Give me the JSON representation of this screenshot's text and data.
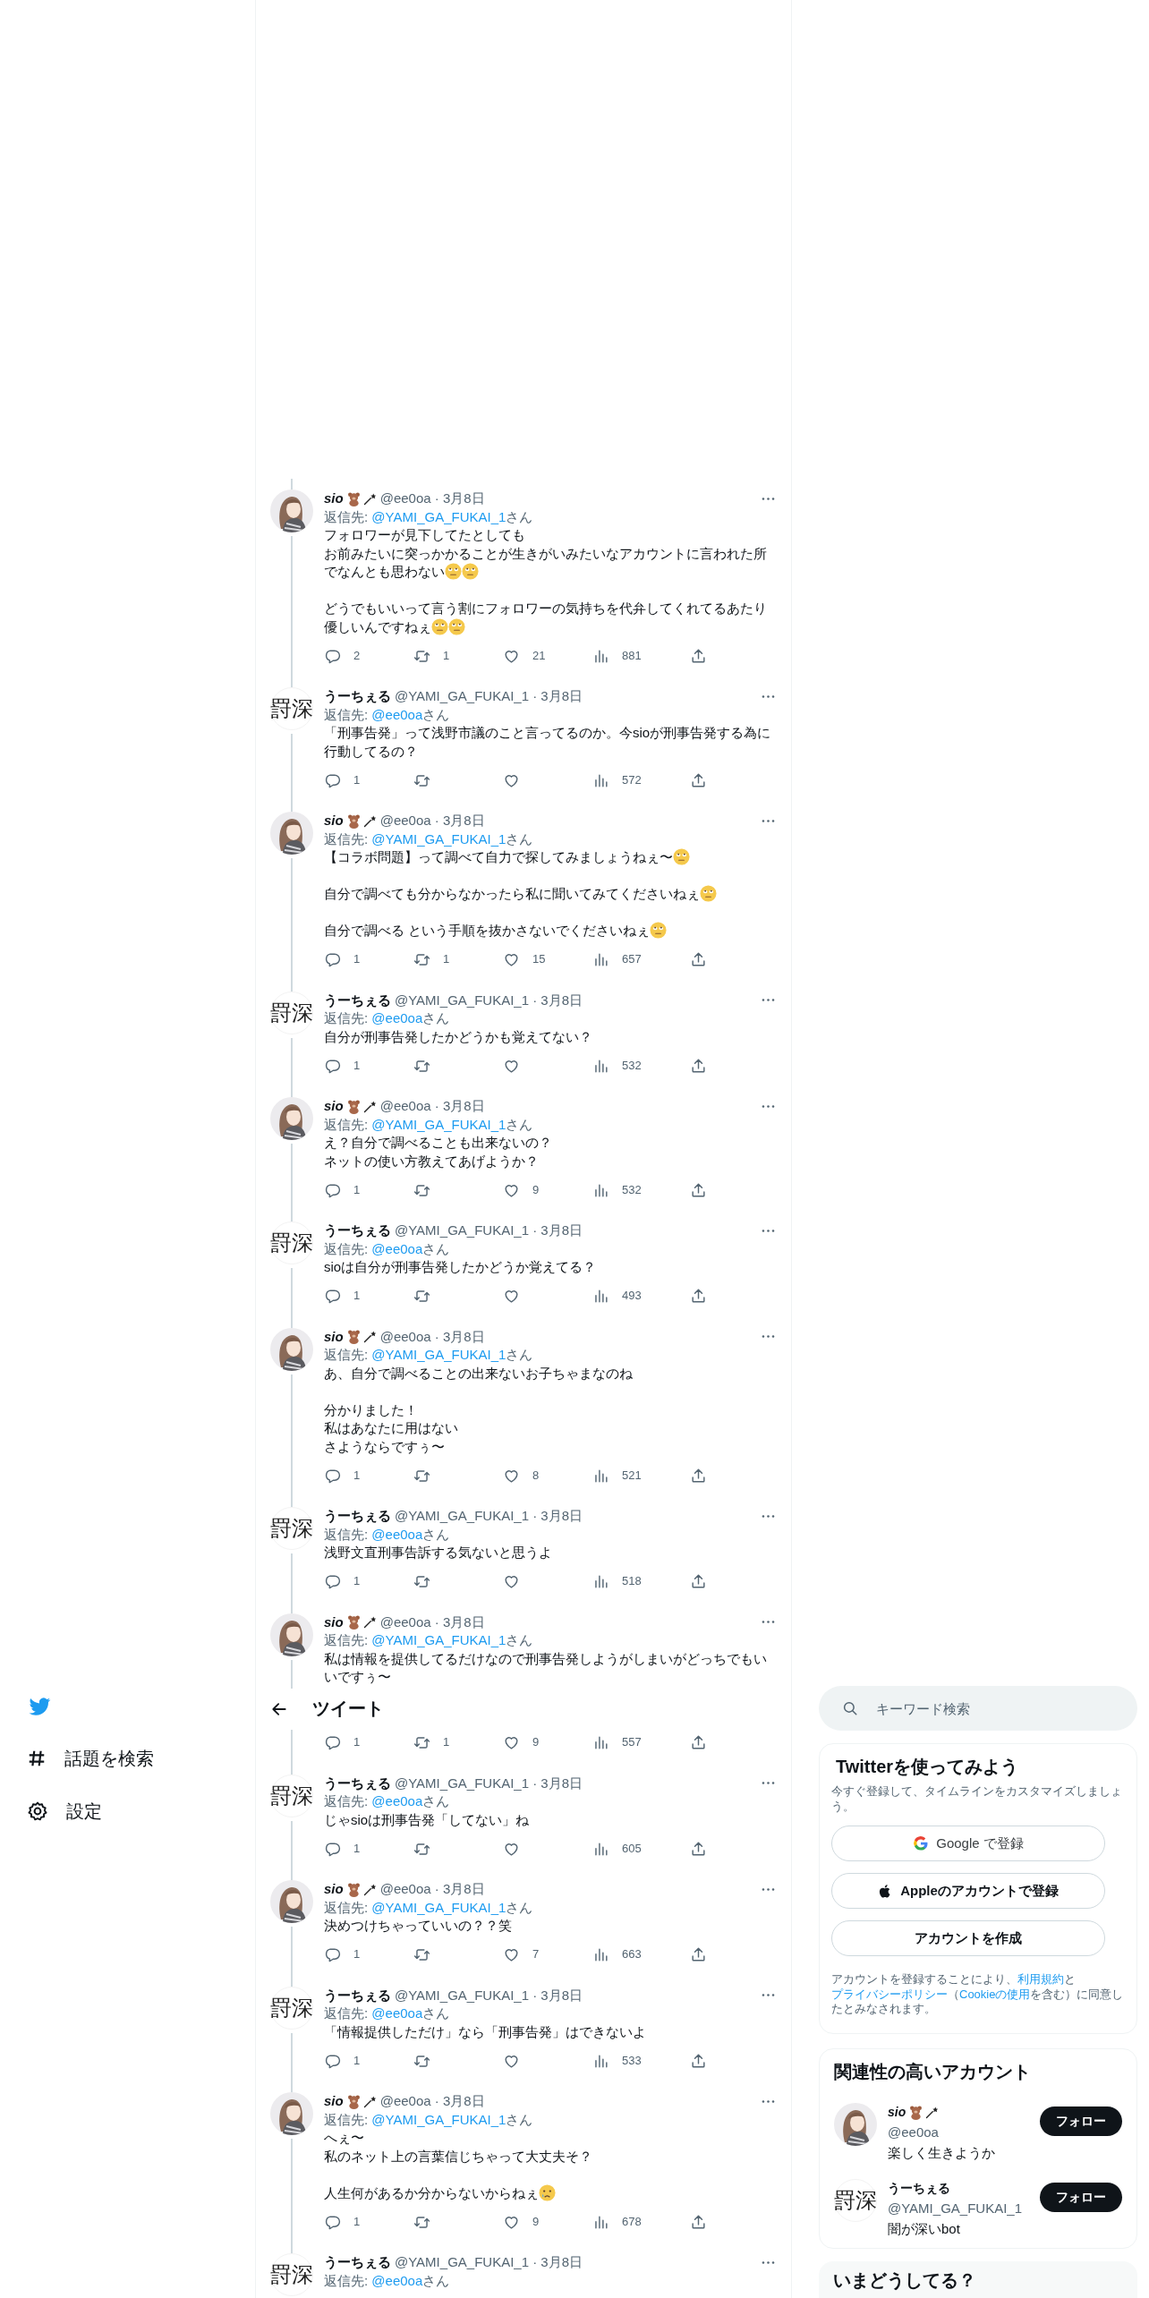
{
  "nav": {
    "items": [
      {
        "kind": "hash",
        "label": "話題を検索"
      },
      {
        "kind": "gear",
        "label": "設定"
      }
    ]
  },
  "header": {
    "title": "ツイート"
  },
  "tweets": [
    {
      "avatar": {
        "kind": "figure"
      },
      "name": "sio",
      "name_italic": true,
      "name_icons": [
        {
          "kind": "teddy"
        },
        {
          "kind": "wand"
        }
      ],
      "byline": "@ee0oa · 3月8日",
      "reply_label": "返信先:",
      "reply_to": "@YAMI_GA_FUKAI_1",
      "reply_suffix": "さん",
      "paragraphs": [
        {
          "lines": [
            "フォロワーが見下してたとしても",
            "お前みたいに突っかかることが生きがいみたいなアカウントに言われた所",
            "でなんとも思わない"
          ],
          "emoji": [
            {
              "kind": "eye-roll"
            },
            {
              "kind": "eye-roll"
            }
          ]
        },
        {
          "lines": [
            "どうでもいいって言う割にフォロワーの気持ちを代弁してくれてるあたり",
            "優しいんですねぇ"
          ],
          "emoji": [
            {
              "kind": "eye-roll"
            },
            {
              "kind": "eye-roll"
            }
          ]
        }
      ],
      "replies": "2",
      "retweets": "1",
      "likes": "21",
      "views": "881",
      "cut_by_header": false
    },
    {
      "avatar": {
        "kind": "text",
        "text": "罸深"
      },
      "name": "うーちぇる",
      "name_italic": false,
      "byline": "@YAMI_GA_FUKAI_1 · 3月8日",
      "reply_label": "返信先:",
      "reply_to": "@ee0oa",
      "reply_suffix": "さん",
      "paragraphs": [
        {
          "lines": [
            "「刑事告発」って浅野市議のこと言ってるのか。今sioが刑事告発する為に",
            "行動してるの？"
          ]
        }
      ],
      "replies": "1",
      "views": "572",
      "cut_by_header": false
    },
    {
      "avatar": {
        "kind": "figure"
      },
      "name": "sio",
      "name_italic": true,
      "name_icons": [
        {
          "kind": "teddy"
        },
        {
          "kind": "wand"
        }
      ],
      "byline": "@ee0oa · 3月8日",
      "reply_label": "返信先:",
      "reply_to": "@YAMI_GA_FUKAI_1",
      "reply_suffix": "さん",
      "paragraphs": [
        {
          "lines": [
            "【コラボ問題】って調べて自力で探してみましょうねぇ〜"
          ],
          "emoji": [
            {
              "kind": "eye-roll"
            }
          ]
        },
        {
          "lines": [
            "自分で調べても分からなかったら私に聞いてみてくださいねぇ"
          ],
          "emoji": [
            {
              "kind": "eye-roll"
            }
          ]
        },
        {
          "lines": [
            "自分で調べる という手順を抜かさないでくださいねぇ"
          ],
          "emoji": [
            {
              "kind": "eye-roll"
            }
          ]
        }
      ],
      "replies": "1",
      "retweets": "1",
      "likes": "15",
      "views": "657",
      "cut_by_header": false
    },
    {
      "avatar": {
        "kind": "text",
        "text": "罸深"
      },
      "name": "うーちぇる",
      "name_italic": false,
      "byline": "@YAMI_GA_FUKAI_1 · 3月8日",
      "reply_label": "返信先:",
      "reply_to": "@ee0oa",
      "reply_suffix": "さん",
      "paragraphs": [
        {
          "lines": [
            "自分が刑事告発したかどうかも覚えてない？"
          ]
        }
      ],
      "replies": "1",
      "views": "532",
      "cut_by_header": false
    },
    {
      "avatar": {
        "kind": "figure"
      },
      "name": "sio",
      "name_italic": true,
      "name_icons": [
        {
          "kind": "teddy"
        },
        {
          "kind": "wand"
        }
      ],
      "byline": "@ee0oa · 3月8日",
      "reply_label": "返信先:",
      "reply_to": "@YAMI_GA_FUKAI_1",
      "reply_suffix": "さん",
      "paragraphs": [
        {
          "lines": [
            "え？自分で調べることも出来ないの？",
            "ネットの使い方教えてあげようか？"
          ]
        }
      ],
      "replies": "1",
      "likes": "9",
      "views": "532",
      "cut_by_header": false
    },
    {
      "avatar": {
        "kind": "text",
        "text": "罸深"
      },
      "name": "うーちぇる",
      "name_italic": false,
      "byline": "@YAMI_GA_FUKAI_1 · 3月8日",
      "reply_label": "返信先:",
      "reply_to": "@ee0oa",
      "reply_suffix": "さん",
      "paragraphs": [
        {
          "lines": [
            "sioは自分が刑事告発したかどうか覚えてる？"
          ]
        }
      ],
      "replies": "1",
      "views": "493",
      "cut_by_header": false
    },
    {
      "avatar": {
        "kind": "figure"
      },
      "name": "sio",
      "name_italic": true,
      "name_icons": [
        {
          "kind": "teddy"
        },
        {
          "kind": "wand"
        }
      ],
      "byline": "@ee0oa · 3月8日",
      "reply_label": "返信先:",
      "reply_to": "@YAMI_GA_FUKAI_1",
      "reply_suffix": "さん",
      "paragraphs": [
        {
          "lines": [
            "あ、自分で調べることの出来ないお子ちゃまなのね"
          ]
        },
        {
          "lines": [
            "分かりました！",
            "私はあなたに用はない",
            "さようならですぅ〜"
          ]
        }
      ],
      "replies": "1",
      "likes": "8",
      "views": "521",
      "cut_by_header": false
    },
    {
      "avatar": {
        "kind": "text",
        "text": "罸深"
      },
      "name": "うーちぇる",
      "name_italic": false,
      "byline": "@YAMI_GA_FUKAI_1 · 3月8日",
      "reply_label": "返信先:",
      "reply_to": "@ee0oa",
      "reply_suffix": "さん",
      "paragraphs": [
        {
          "lines": [
            "浅野文直刑事告訴する気ないと思うよ"
          ]
        }
      ],
      "replies": "1",
      "views": "518",
      "cut_by_header": false
    },
    {
      "avatar": {
        "kind": "figure"
      },
      "name": "sio",
      "name_italic": true,
      "name_icons": [
        {
          "kind": "teddy"
        },
        {
          "kind": "wand"
        }
      ],
      "byline": "@ee0oa · 3月8日",
      "reply_label": "返信先:",
      "reply_to": "@YAMI_GA_FUKAI_1",
      "reply_suffix": "さん",
      "paragraphs": [
        {
          "lines": [
            "私は情報を提供してるだけなので刑事告発しようがしまいがどっちでもい",
            "いですぅ〜"
          ]
        }
      ],
      "replies": "1",
      "retweets": "1",
      "likes": "9",
      "views": "557",
      "cut_by_header": true
    },
    {
      "avatar": {
        "kind": "text",
        "text": "罸深"
      },
      "name": "うーちぇる",
      "name_italic": false,
      "byline": "@YAMI_GA_FUKAI_1 · 3月8日",
      "reply_label": "返信先:",
      "reply_to": "@ee0oa",
      "reply_suffix": "さん",
      "paragraphs": [
        {
          "lines": [
            "じゃsioは刑事告発「してない」ね"
          ]
        }
      ],
      "replies": "1",
      "views": "605",
      "cut_by_header": false
    },
    {
      "avatar": {
        "kind": "figure"
      },
      "name": "sio",
      "name_italic": true,
      "name_icons": [
        {
          "kind": "teddy"
        },
        {
          "kind": "wand"
        }
      ],
      "byline": "@ee0oa · 3月8日",
      "reply_label": "返信先:",
      "reply_to": "@YAMI_GA_FUKAI_1",
      "reply_suffix": "さん",
      "paragraphs": [
        {
          "lines": [
            "決めつけちゃっていいの？？笑"
          ]
        }
      ],
      "replies": "1",
      "likes": "7",
      "views": "663",
      "cut_by_header": false
    },
    {
      "avatar": {
        "kind": "text",
        "text": "罸深"
      },
      "name": "うーちぇる",
      "name_italic": false,
      "byline": "@YAMI_GA_FUKAI_1 · 3月8日",
      "reply_label": "返信先:",
      "reply_to": "@ee0oa",
      "reply_suffix": "さん",
      "paragraphs": [
        {
          "lines": [
            "「情報提供しただけ」なら「刑事告発」はできないよ"
          ]
        }
      ],
      "replies": "1",
      "views": "533",
      "cut_by_header": false
    },
    {
      "avatar": {
        "kind": "figure"
      },
      "name": "sio",
      "name_italic": true,
      "name_icons": [
        {
          "kind": "teddy"
        },
        {
          "kind": "wand"
        }
      ],
      "byline": "@ee0oa · 3月8日",
      "reply_label": "返信先:",
      "reply_to": "@YAMI_GA_FUKAI_1",
      "reply_suffix": "さん",
      "paragraphs": [
        {
          "lines": [
            "へぇ〜",
            "私のネット上の言葉信じちゃって大丈夫そ？"
          ]
        },
        {
          "lines": [
            "人生何があるか分からないからねぇ"
          ],
          "emoji": [
            {
              "kind": "crying"
            }
          ]
        }
      ],
      "replies": "1",
      "likes": "9",
      "views": "678",
      "cut_by_header": false
    },
    {
      "avatar": {
        "kind": "text",
        "text": "罸深"
      },
      "name": "うーちぇる",
      "name_italic": false,
      "byline": "@YAMI_GA_FUKAI_1 · 3月8日",
      "reply_label": "返信先:",
      "reply_to": "@ee0oa",
      "reply_suffix": "さん",
      "cut_by_header": false
    }
  ],
  "search": {
    "placeholder": "キーワード検索"
  },
  "signup": {
    "title": "Twitterを使ってみよう",
    "subtitle": "今すぐ登録して、タイムラインをカスタマイズしましょう。",
    "buttons": [
      {
        "kind": "google",
        "label": "Google で登録"
      },
      {
        "kind": "apple",
        "label": "Appleのアカウントで登録"
      },
      {
        "kind": "plain",
        "label": "アカウントを作成"
      }
    ],
    "legal": [
      {
        "text": "アカウントを登録することにより、",
        "link": false
      },
      {
        "text": "利用規約",
        "link": true
      },
      {
        "text": "と",
        "link": false
      },
      {
        "text": "プライバシーポリシー",
        "link": true
      },
      {
        "text": "（",
        "link": false
      },
      {
        "text": "Cookieの使用",
        "link": true
      },
      {
        "text": "を含む）に同意したとみなされます。",
        "link": false
      }
    ]
  },
  "related": {
    "title": "関連性の高いアカウント",
    "accounts": [
      {
        "avatar": {
          "kind": "figure"
        },
        "name": "sio",
        "name_italic": true,
        "name_icons": [
          {
            "kind": "teddy"
          },
          {
            "kind": "wand"
          }
        ],
        "handle": "@ee0oa",
        "bio": "楽しく生きようか",
        "follow": "フォロー"
      },
      {
        "avatar": {
          "kind": "text",
          "text": "罸深"
        },
        "name": "うーちぇる",
        "name_italic": false,
        "handle": "@YAMI_GA_FUKAI_1",
        "bio": "闇が深いbot",
        "follow": "フォロー"
      }
    ]
  },
  "trends": {
    "title": "いまどうしてる？"
  }
}
